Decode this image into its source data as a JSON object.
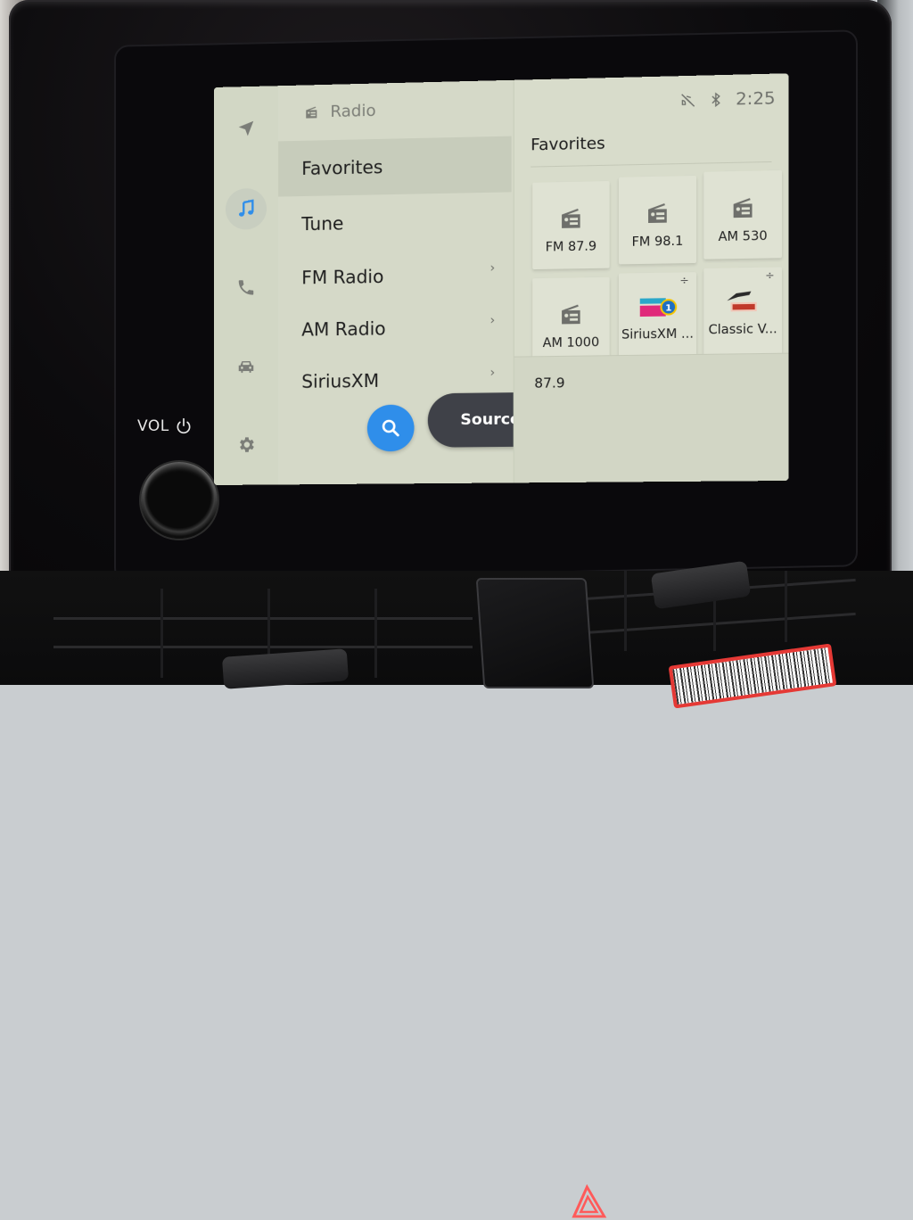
{
  "device": {
    "volume_label": "VOL",
    "hazard_icon": "hazard-triangle-icon"
  },
  "rail": {
    "items": [
      {
        "name": "navigation",
        "icon": "navigation-arrow-icon",
        "active": false
      },
      {
        "name": "media",
        "icon": "music-note-icon",
        "active": true
      },
      {
        "name": "phone",
        "icon": "phone-icon",
        "active": false
      },
      {
        "name": "vehicle",
        "icon": "car-icon",
        "active": false
      },
      {
        "name": "settings",
        "icon": "gear-icon",
        "active": false
      }
    ],
    "accent_color": "#2f8eea"
  },
  "menu": {
    "header": "Radio",
    "items": [
      {
        "label": "Favorites",
        "selected": true,
        "has_chevron": false
      },
      {
        "label": "Tune",
        "selected": false,
        "has_chevron": false
      },
      {
        "label": "FM Radio",
        "selected": false,
        "has_chevron": true
      },
      {
        "label": "AM Radio",
        "selected": false,
        "has_chevron": true
      },
      {
        "label": "SiriusXM",
        "selected": false,
        "has_chevron": true
      }
    ],
    "chevron": "›",
    "sources_label": "Sources"
  },
  "status": {
    "time": "2:25",
    "icons": [
      "voice-muted-icon",
      "bluetooth-icon"
    ]
  },
  "favorites": {
    "title": "Favorites",
    "tiles": [
      {
        "label": "FM 87.9",
        "type": "radio"
      },
      {
        "label": "FM 98.1",
        "type": "radio"
      },
      {
        "label": "AM 530",
        "type": "radio"
      },
      {
        "label": "AM 1000",
        "type": "radio"
      },
      {
        "label": "SiriusXM ...",
        "type": "sirius-logo",
        "plus": "÷"
      },
      {
        "label": "Classic V...",
        "type": "vinyl-logo",
        "plus": "÷"
      }
    ]
  },
  "now_playing": {
    "station": "87.9"
  }
}
